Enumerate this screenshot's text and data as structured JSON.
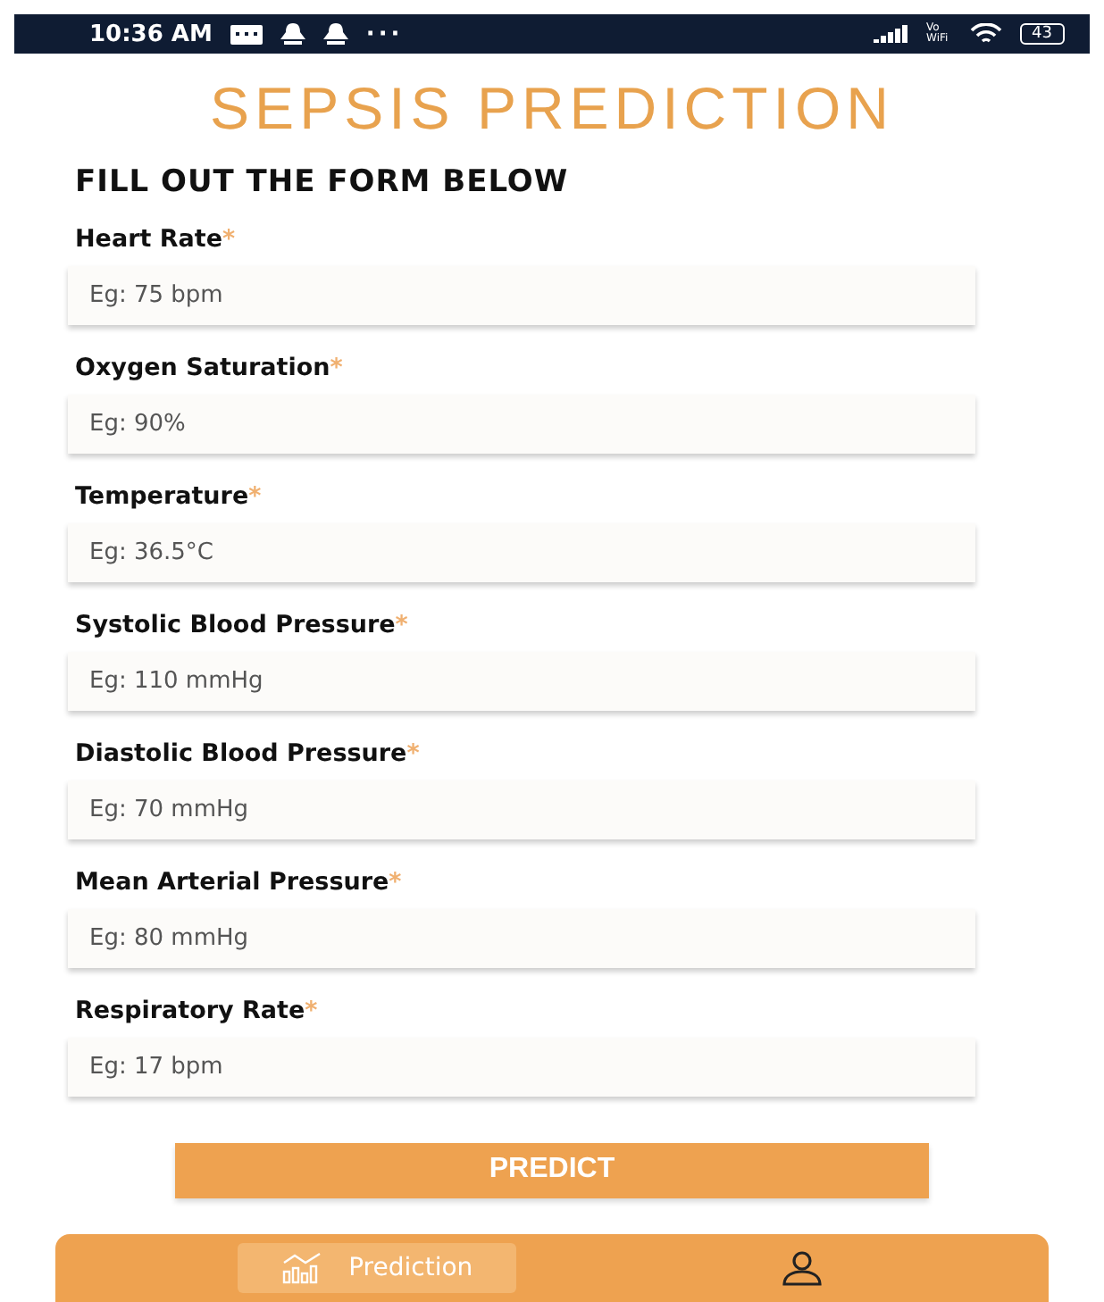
{
  "status_bar": {
    "time": "10:36 AM",
    "more": "···",
    "volte": "Vo WiFi",
    "battery": "43"
  },
  "title": "SEPSIS PREDICTION",
  "subtitle": "FILL OUT THE FORM BELOW",
  "fields": [
    {
      "label": "Heart Rate",
      "mark": "*",
      "placeholder": "Eg: 75 bpm"
    },
    {
      "label": "Oxygen Saturation",
      "mark": "*",
      "placeholder": "Eg: 90%"
    },
    {
      "label": "Temperature",
      "mark": "*",
      "placeholder": "Eg: 36.5°C"
    },
    {
      "label": "Systolic Blood Pressure",
      "mark": "*",
      "placeholder": "Eg: 110 mmHg"
    },
    {
      "label": "Diastolic Blood Pressure",
      "mark": "*",
      "placeholder": "Eg: 70 mmHg"
    },
    {
      "label": "Mean Arterial Pressure",
      "mark": "*",
      "placeholder": "Eg: 80 mmHg"
    },
    {
      "label": "Respiratory Rate",
      "mark": "*",
      "placeholder": "Eg: 17 bpm"
    }
  ],
  "button": "PREDICT",
  "nav": [
    {
      "kind": "chart",
      "label": "Prediction",
      "selected": true
    },
    {
      "kind": "profile",
      "selected": false
    }
  ]
}
